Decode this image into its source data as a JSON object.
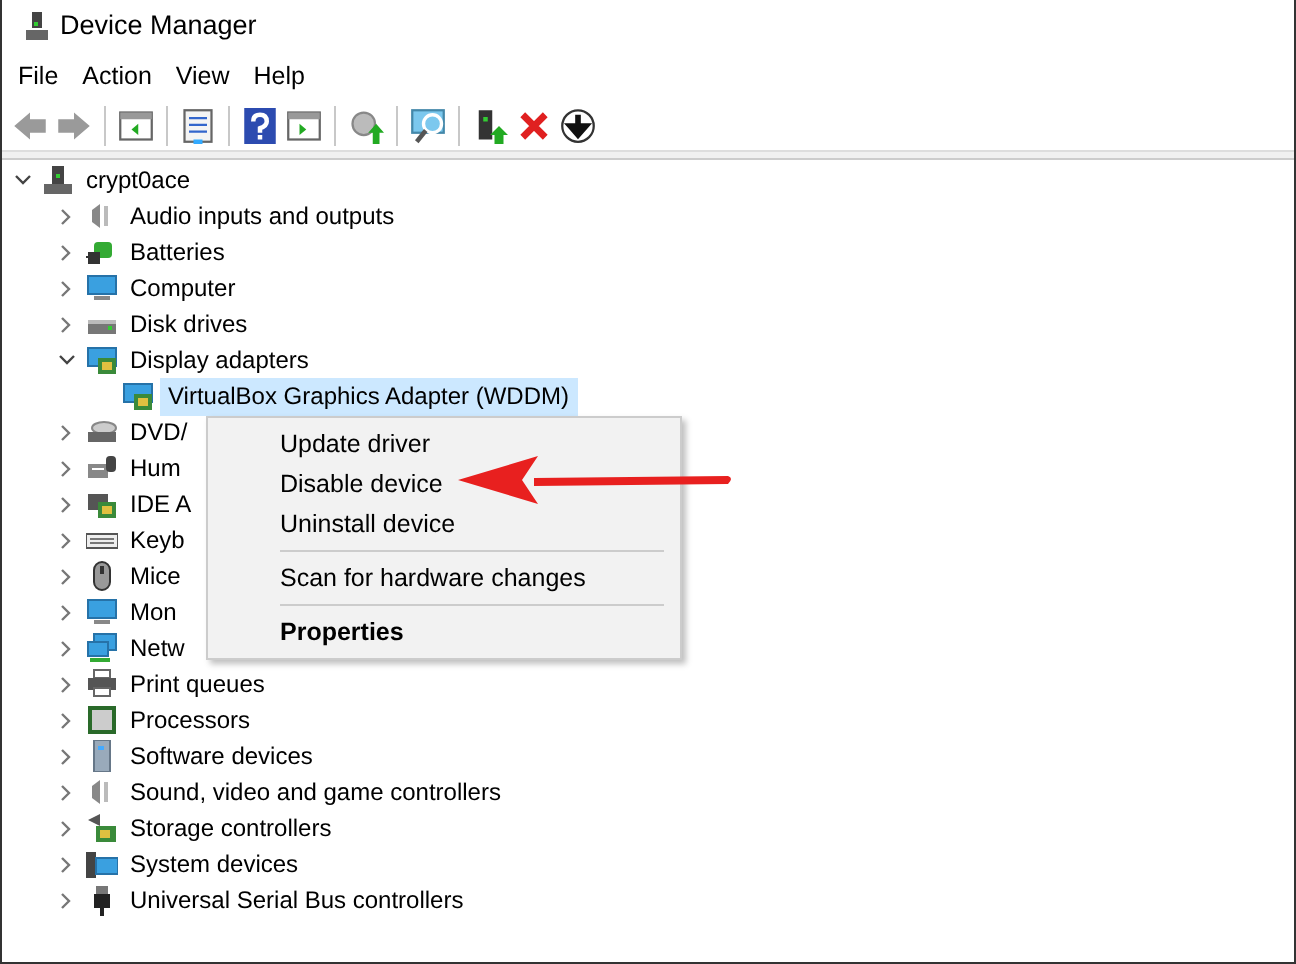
{
  "window": {
    "title": "Device Manager"
  },
  "menu_bar": [
    "File",
    "Action",
    "View",
    "Help"
  ],
  "tree": {
    "label": "crypt0ace",
    "expanded": true,
    "selected": false,
    "children": [
      {
        "label": "Audio inputs and outputs",
        "expanded": false,
        "selected": false
      },
      {
        "label": "Batteries",
        "expanded": false,
        "selected": false
      },
      {
        "label": "Computer",
        "expanded": false,
        "selected": false
      },
      {
        "label": "Disk drives",
        "expanded": false,
        "selected": false
      },
      {
        "label": "Display adapters",
        "expanded": true,
        "selected": false,
        "children": [
          {
            "label": "VirtualBox Graphics Adapter (WDDM)",
            "selected": true
          }
        ]
      },
      {
        "label": "DVD/",
        "expanded": false,
        "selected": false
      },
      {
        "label": "Hum",
        "expanded": false,
        "selected": false
      },
      {
        "label": "IDE A",
        "expanded": false,
        "selected": false
      },
      {
        "label": "Keyb",
        "expanded": false,
        "selected": false
      },
      {
        "label": "Mice",
        "expanded": false,
        "selected": false
      },
      {
        "label": "Mon",
        "expanded": false,
        "selected": false
      },
      {
        "label": "Netw",
        "expanded": false,
        "selected": false
      },
      {
        "label": "Print queues",
        "expanded": false,
        "selected": false
      },
      {
        "label": "Processors",
        "expanded": false,
        "selected": false
      },
      {
        "label": "Software devices",
        "expanded": false,
        "selected": false
      },
      {
        "label": "Sound, video and game controllers",
        "expanded": false,
        "selected": false
      },
      {
        "label": "Storage controllers",
        "expanded": false,
        "selected": false
      },
      {
        "label": "System devices",
        "expanded": false,
        "selected": false
      },
      {
        "label": "Universal Serial Bus controllers",
        "expanded": false,
        "selected": false
      }
    ]
  },
  "context_menu": [
    {
      "kind": "item",
      "label": "Update driver",
      "default": false
    },
    {
      "kind": "item",
      "label": "Disable device",
      "default": false
    },
    {
      "kind": "item",
      "label": "Uninstall device",
      "default": false
    },
    {
      "kind": "separator"
    },
    {
      "kind": "item",
      "label": "Scan for hardware changes",
      "default": false
    },
    {
      "kind": "separator"
    },
    {
      "kind": "item",
      "label": "Properties",
      "default": true
    }
  ]
}
